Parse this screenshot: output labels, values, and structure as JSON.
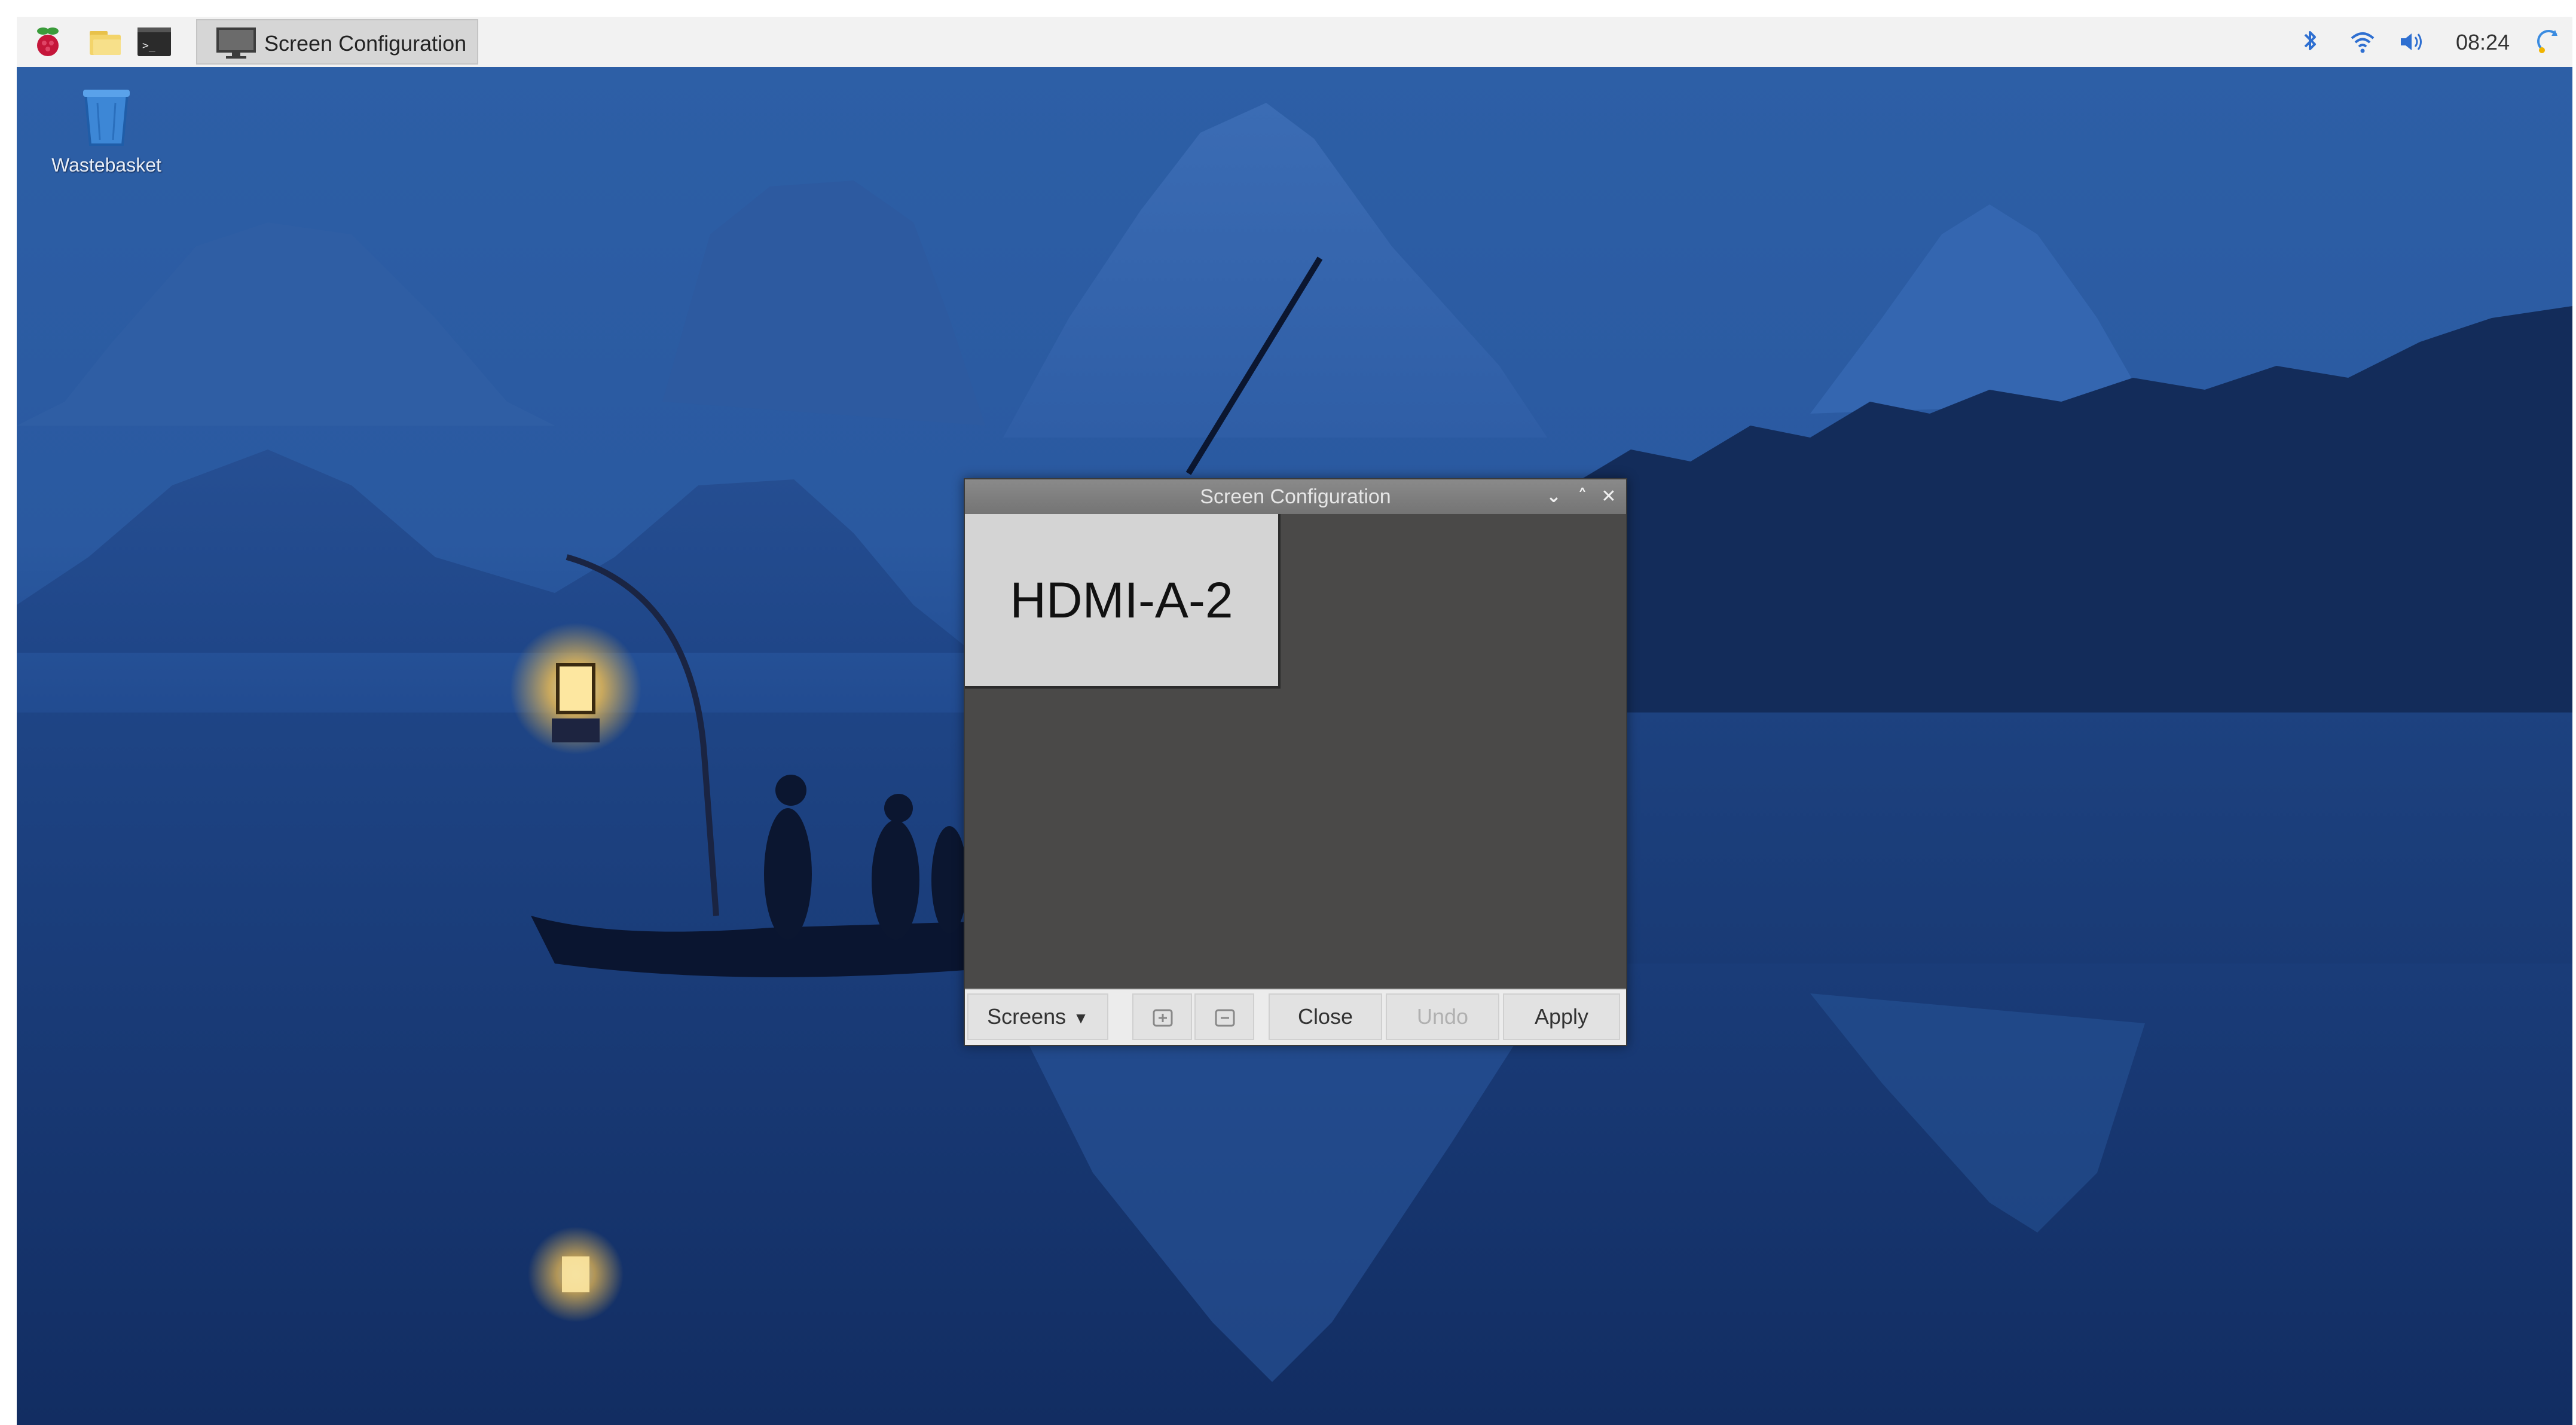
{
  "taskbar": {
    "task_label": "Screen Configuration",
    "clock": "08:24",
    "icons": [
      "raspberry-menu-icon",
      "file-manager-icon",
      "terminal-icon",
      "bluetooth-icon",
      "wifi-icon",
      "volume-icon",
      "update-icon"
    ]
  },
  "desktop": {
    "wastebasket_label": "Wastebasket"
  },
  "window": {
    "title": "Screen Configuration",
    "monitor_label": "HDMI-A-2",
    "controls": {
      "minimize": "⌄",
      "maximize": "˄",
      "close": "✕"
    },
    "buttons": {
      "screens": "Screens",
      "close": "Close",
      "undo": "Undo",
      "apply": "Apply"
    }
  },
  "colors": {
    "taskbar_bg": "#f2f2f2",
    "window_canvas": "#4a4948",
    "titlebar": "#7f7f7f",
    "monitor_box": "#d4d4d4",
    "bluetooth": "#2e6fd1"
  }
}
